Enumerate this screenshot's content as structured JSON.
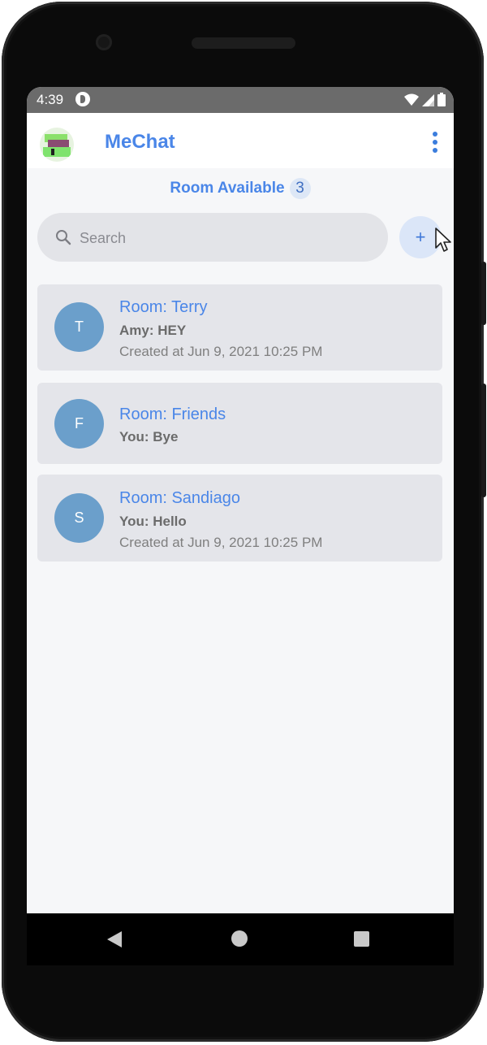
{
  "status_bar": {
    "time": "4:39",
    "icons": [
      "app-notification-icon",
      "wifi-icon",
      "signal-icon",
      "battery-icon"
    ]
  },
  "app_bar": {
    "title": "MeChat",
    "logo": "app-logo",
    "menu_icon": "more-vert-icon",
    "accent_color": "#4a86e8"
  },
  "rooms_header": {
    "label": "Room Available",
    "count": "3"
  },
  "search": {
    "placeholder": "Search",
    "icon": "search-icon"
  },
  "add_button": {
    "label": "+"
  },
  "rooms": [
    {
      "initial": "T",
      "name": "Room: Terry",
      "last_message": "Amy: HEY",
      "created": "Created at Jun 9, 2021 10:25 PM"
    },
    {
      "initial": "F",
      "name": "Room: Friends",
      "last_message": "You: Bye",
      "created": ""
    },
    {
      "initial": "S",
      "name": "Room: Sandiago",
      "last_message": "You: Hello",
      "created": "Created at Jun 9, 2021 10:25 PM"
    }
  ],
  "nav_bar": {
    "icons": [
      "back-icon",
      "home-icon",
      "recents-icon"
    ]
  },
  "colors": {
    "room_avatar": "#6b9fcb",
    "card_bg": "#e4e5ea",
    "status_bar": "#6b6b6b"
  }
}
